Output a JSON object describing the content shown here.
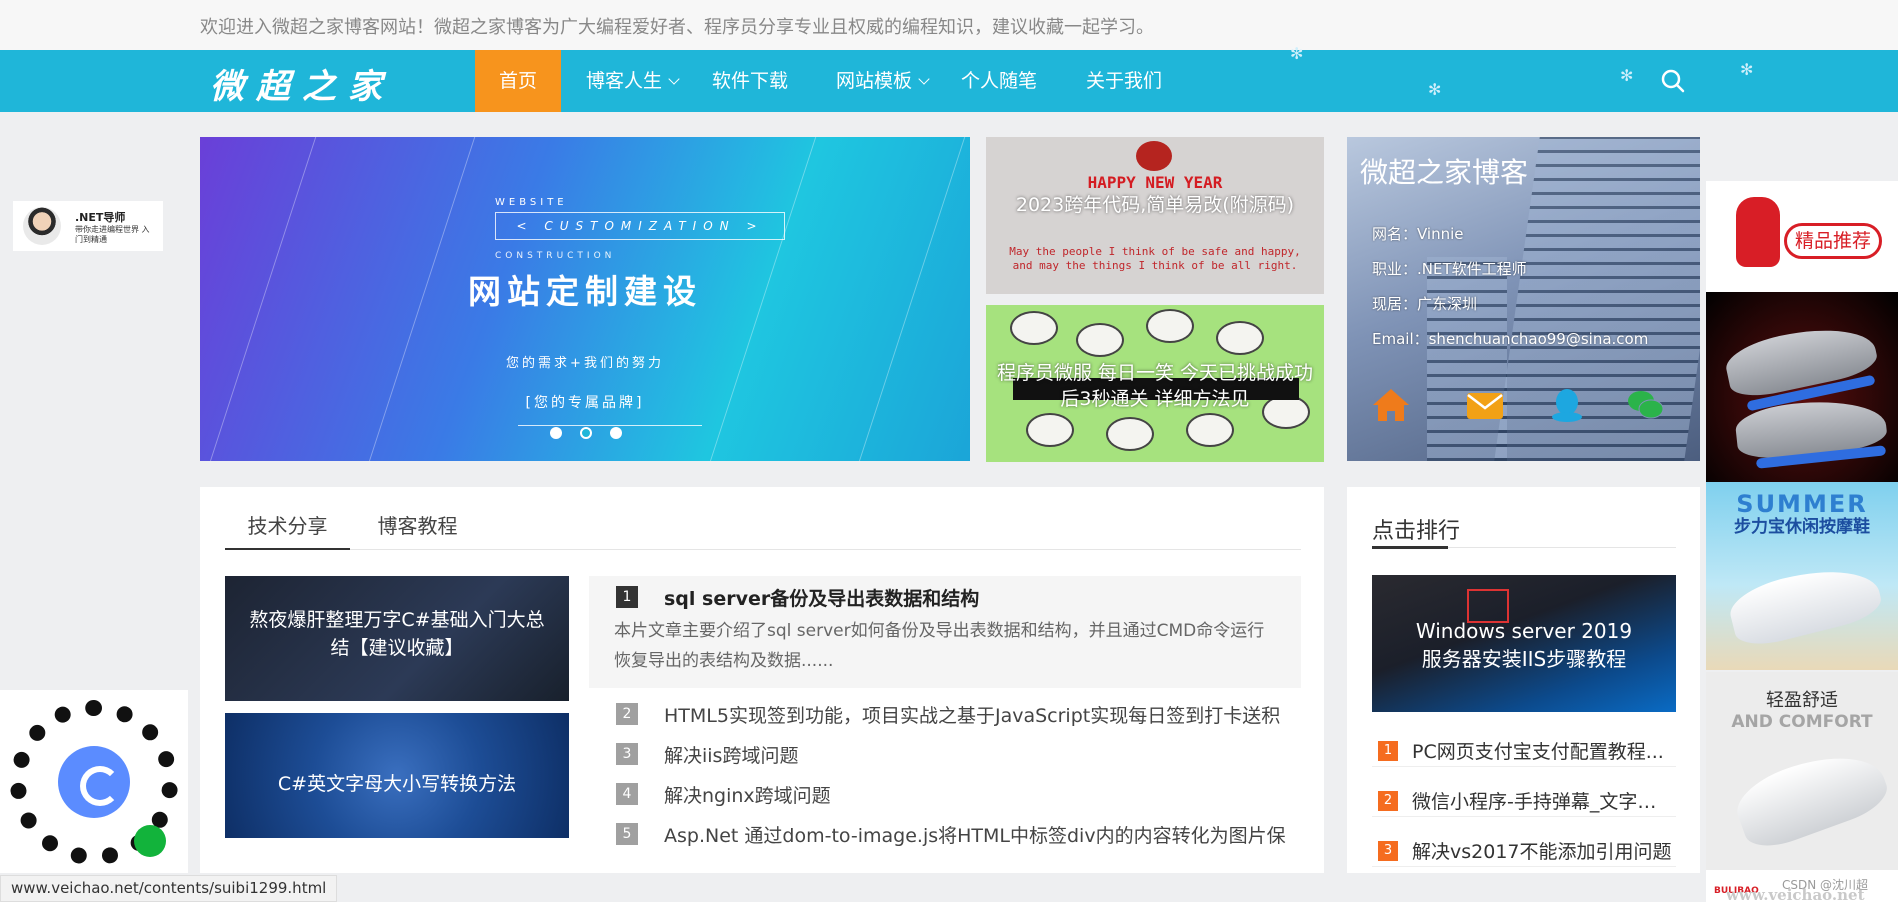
{
  "topbar": {
    "welcome": "欢迎进入微超之家博客网站！微超之家博客为广大编程爱好者、程序员分享专业且权威的编程知识，建议收藏一起学习。"
  },
  "nav": {
    "logo": "微超之家",
    "items": [
      {
        "label": "首页"
      },
      {
        "label": "博客人生"
      },
      {
        "label": "软件下载"
      },
      {
        "label": "网站模板"
      },
      {
        "label": "个人随笔"
      },
      {
        "label": "关于我们"
      }
    ]
  },
  "banner": {
    "tag_top": "WEBSITE",
    "tag_main": "< CUSTOMIZATION >",
    "tag_bottom": "CONSTRUCTION",
    "title": "网站定制建设",
    "slogan": "您的需求+我们的努力",
    "brand": "[您的专属品牌]"
  },
  "mini_cards": [
    {
      "title": "2023跨年代码,简单易改(附源码)",
      "image_text": "HAPPY NEW YEAR",
      "image_small": "May the people I think of be safe and happy, and may the things I think of be all right."
    },
    {
      "title": "程序员微服 每日一笑 今天已挑战成功 后3秒通关 详细方法见"
    }
  ],
  "profile": {
    "title": "微超之家博客",
    "name_row": "网名：Vinnie",
    "job_row": "职业：.NET软件工程师",
    "location_row": "现居：广东深圳",
    "email_row": "Email：shenchuanchao99@sina.com",
    "icons": [
      "home-icon",
      "mail-icon",
      "qq-icon",
      "wechat-icon"
    ]
  },
  "tech": {
    "tabs": [
      {
        "label": "技术分享"
      },
      {
        "label": "博客教程"
      }
    ],
    "thumbs": [
      {
        "title": "熬夜爆肝整理万字C#基础入门大总结【建议收藏】"
      },
      {
        "title": "C#英文字母大小写转换方法"
      }
    ],
    "featured": {
      "num": "1",
      "title": "sql server备份及导出表数据和结构",
      "desc": "本片文章主要介绍了sql server如何备份及导出表数据和结构，并且通过CMD命令运行恢复导出的表结构及数据......"
    },
    "articles": [
      {
        "num": "2",
        "title": "HTML5实现签到功能，项目实战之基于JavaScript实现每日签到打卡送积"
      },
      {
        "num": "3",
        "title": "解决iis跨域问题"
      },
      {
        "num": "4",
        "title": "解决nginx跨域问题"
      },
      {
        "num": "5",
        "title": "Asp.Net 通过dom-to-image.js将HTML中标签div内的内容转化为图片保"
      }
    ]
  },
  "rank": {
    "title": "点击排行",
    "thumb_title": "Windows server 2019 服务器安装IIS步骤教程",
    "items": [
      {
        "num": "1",
        "title": "PC网页支付宝支付配置教程..."
      },
      {
        "num": "2",
        "title": "微信小程序-手持弹幕_文字内..."
      },
      {
        "num": "3",
        "title": "解决vs2017不能添加引用问题"
      }
    ]
  },
  "left_ads": {
    "badge_title": ".NET导师",
    "badge_sub": "带你走进编程世界 入门到精通"
  },
  "right_ads": {
    "ad1_text": "精品推荐",
    "ad3_top": "SUMMER",
    "ad3_sub": "步力宝休闲按摩鞋",
    "ad4_title": "轻盈舒适",
    "ad4_sub": "AND COMFORT",
    "ad5_brand": "BULIBAO"
  },
  "status_url": "www.veichao.net/contents/suibi1299.html",
  "watermark": "CSDN @沈川超",
  "watermark2": "www.veichao.net",
  "colors": {
    "nav_bg": "#1fb6d9",
    "nav_active": "#f7941d",
    "rank_num": "#f56c1f"
  }
}
